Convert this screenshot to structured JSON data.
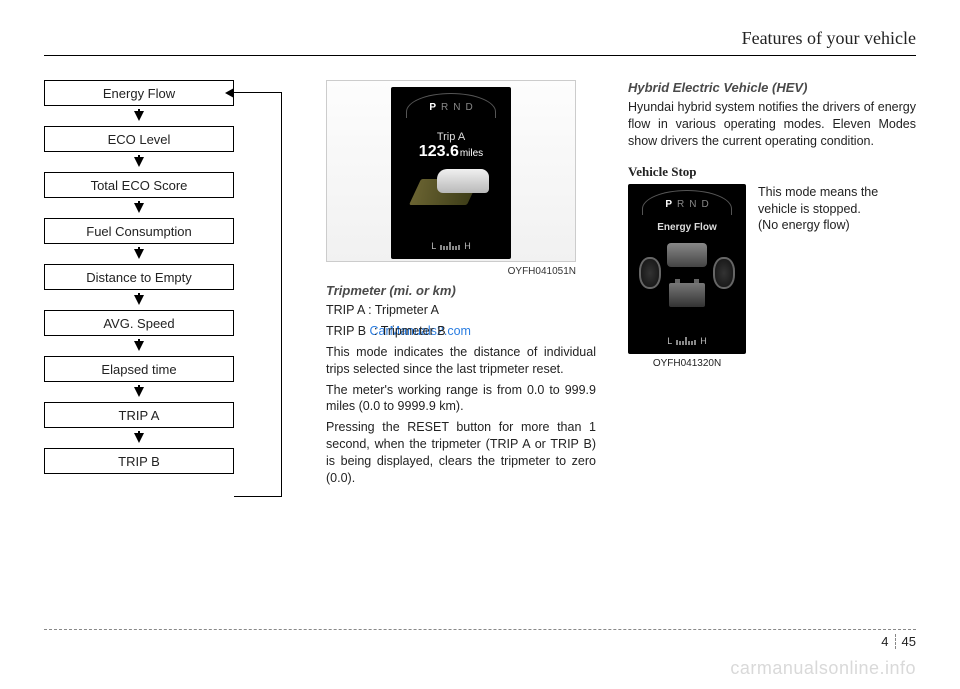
{
  "header": {
    "title": "Features of your vehicle"
  },
  "flow": {
    "items": [
      "Energy Flow",
      "ECO Level",
      "Total ECO Score",
      "Fuel Consumption",
      "Distance to Empty",
      "AVG. Speed",
      "Elapsed time",
      "TRIP A",
      "TRIP B"
    ]
  },
  "screen1": {
    "gear": {
      "options": [
        "P",
        "R",
        "N",
        "D"
      ],
      "active": "P"
    },
    "trip_label": "Trip A",
    "trip_value": "123.6",
    "trip_unit": "miles",
    "gauge": {
      "low": "L",
      "high": "H"
    },
    "caption": "OYFH041051N"
  },
  "tripmeter": {
    "heading": "Tripmeter (mi. or km)",
    "line_a": "TRIP A : Tripmeter A",
    "line_b_pre": "TRIP B ",
    "line_b_mid_prefix": ": Tripmeter B",
    "watermark": "CarManuals2.com",
    "p1": "This mode indicates the distance of individual trips selected since the last tripmeter reset.",
    "p2": "The meter's working range is from 0.0 to 999.9 miles (0.0 to 9999.9 km).",
    "p3": "Pressing the RESET button for more than 1 second, when the tripmeter (TRIP A or TRIP B) is being displayed, clears the tripmeter to zero (0.0)."
  },
  "hev": {
    "heading": "Hybrid Electric Vehicle (HEV)",
    "intro": "Hyundai hybrid system notifies the drivers of energy flow in various operating modes.  Eleven Modes show drivers the current operating condition.",
    "stop_heading": "Vehicle Stop",
    "screen2": {
      "title": "Energy Flow",
      "caption": "OYFH041320N",
      "gauge": {
        "low": "L",
        "high": "H"
      }
    },
    "stop_text1": "This mode means the vehicle is stopped.",
    "stop_text2": "(No energy flow)"
  },
  "footer": {
    "section": "4",
    "page": "45"
  },
  "site": "carmanualsonline.info"
}
